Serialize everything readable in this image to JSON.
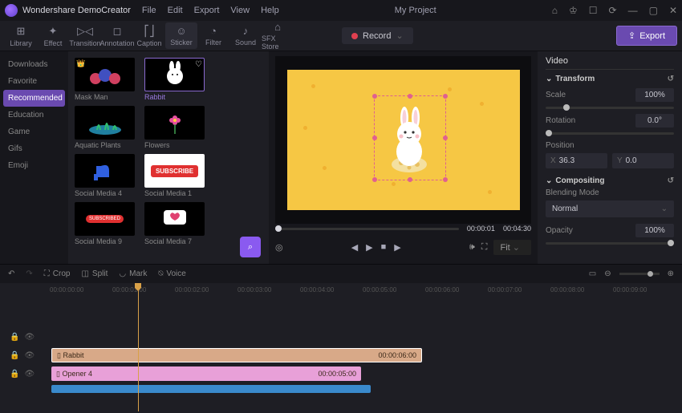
{
  "app": {
    "name": "Wondershare DemoCreator",
    "project": "My Project"
  },
  "menu": [
    "File",
    "Edit",
    "Export",
    "View",
    "Help"
  ],
  "tools": [
    {
      "icon": "⊞",
      "label": "Library"
    },
    {
      "icon": "✦",
      "label": "Effect"
    },
    {
      "icon": "▷◁",
      "label": "Transition"
    },
    {
      "icon": "◻",
      "label": "Annotation"
    },
    {
      "icon": "⎡⎦",
      "label": "Caption"
    },
    {
      "icon": "☺",
      "label": "Sticker"
    },
    {
      "icon": "◔",
      "label": "Filter"
    },
    {
      "icon": "♪",
      "label": "Sound"
    },
    {
      "icon": "⌂",
      "label": "SFX Store"
    }
  ],
  "record": "Record",
  "export": "Export",
  "sidebar": [
    "Downloads",
    "Favorite",
    "Recommended",
    "Education",
    "Game",
    "Gifs",
    "Emoji"
  ],
  "assets": [
    {
      "label": "Mask Man"
    },
    {
      "label": "Rabbit"
    },
    {
      "label": "Aquatic Plants"
    },
    {
      "label": "Flowers"
    },
    {
      "label": "Social Media 4"
    },
    {
      "label": "Social Media 1"
    },
    {
      "label": "Social Media 9"
    },
    {
      "label": "Social Media 7"
    }
  ],
  "preview": {
    "cur": "00:00:01",
    "total": "00:04:30",
    "fit": "Fit"
  },
  "props": {
    "tab": "Video",
    "transform": "Transform",
    "scale_l": "Scale",
    "scale_v": "100%",
    "rotation_l": "Rotation",
    "rotation_v": "0.0°",
    "position_l": "Position",
    "pos_x": "36.3",
    "pos_y": "0.0",
    "compositing": "Compositing",
    "blend_l": "Blending Mode",
    "blend_v": "Normal",
    "opacity_l": "Opacity",
    "opacity_v": "100%"
  },
  "tl": {
    "crop": "Crop",
    "split": "Split",
    "mark": "Mark",
    "voice": "Voice",
    "ruler": [
      "00:00:00:00",
      "00:00:01:00",
      "00:00:02:00",
      "00:00:03:00",
      "00:00:04:00",
      "00:00:05:00",
      "00:00:06:00",
      "00:00:07:00",
      "00:00:08:00",
      "00:00:09:00"
    ],
    "clip1": {
      "name": "Rabbit",
      "dur": "00:00:06:00"
    },
    "clip2": {
      "name": "Opener 4",
      "dur": "00:00:05:00"
    }
  }
}
